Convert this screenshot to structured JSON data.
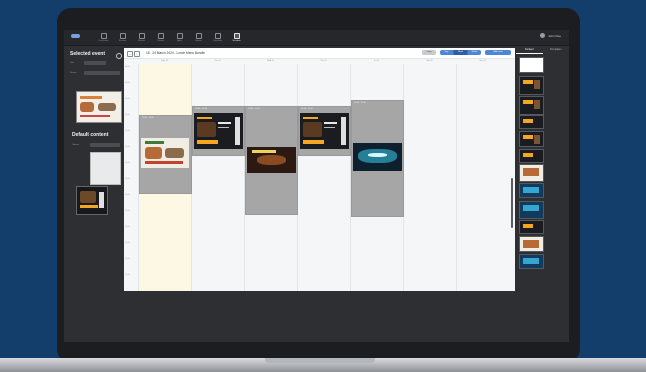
{
  "nav": {
    "items": [
      {
        "label": "Dashboard",
        "icon": "home-icon"
      },
      {
        "label": "Screens",
        "icon": "monitor-icon"
      },
      {
        "label": "Playlists",
        "icon": "list-icon"
      },
      {
        "label": "Content",
        "icon": "image-icon"
      },
      {
        "label": "Apps",
        "icon": "grid-icon"
      },
      {
        "label": "Reports",
        "icon": "chart-icon"
      },
      {
        "label": "Templates",
        "icon": "layout-icon"
      },
      {
        "label": "Schedule",
        "icon": "calendar-icon"
      }
    ],
    "active_index": 7
  },
  "account": {
    "name": "John Doe"
  },
  "left_panel": {
    "title": "Selected event",
    "field1_label": "Title",
    "field2_label": "Screen",
    "default_title": "Default content",
    "default_field_label": "Content"
  },
  "calendar": {
    "title": "18 - 24 March 2024 - Lunch Menu Bundle",
    "prev": "‹",
    "next": "›",
    "today_label": "Today",
    "views": [
      "Day",
      "Week",
      "Month",
      "List"
    ],
    "active_view": 1,
    "add_label": "Add event",
    "days": [
      "Mon 18",
      "Tue 19",
      "Wed 20",
      "Thu 21",
      "Fri 22",
      "Sat 23",
      "Sun 24"
    ],
    "times": [
      "08:00",
      "09:00",
      "10:00",
      "11:00",
      "12:00",
      "13:00",
      "14:00",
      "15:00",
      "16:00",
      "17:00",
      "18:00",
      "19:00",
      "20:00",
      "21:00"
    ],
    "events": [
      {
        "label": "11:00 - 13:00"
      },
      {
        "label": "10:30 - 16:30"
      },
      {
        "label": "10:30 - 12:00"
      },
      {
        "label": "10:30 - 12:00"
      },
      {
        "label": "10:00 - 15:30"
      }
    ]
  },
  "right_panel": {
    "tabs": [
      "Content",
      "Templates"
    ],
    "active_tab": 0
  }
}
